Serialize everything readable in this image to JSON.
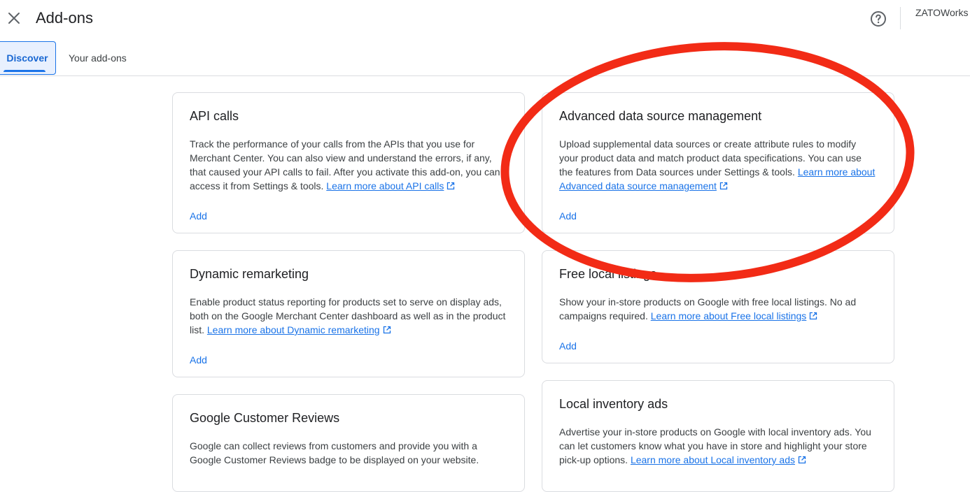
{
  "header": {
    "title": "Add-ons",
    "account": "ZATOWorks",
    "close_icon": "close-icon",
    "help_icon": "help-circle-icon"
  },
  "tabs": [
    {
      "label": "Discover",
      "selected": true
    },
    {
      "label": "Your add-ons",
      "selected": false
    }
  ],
  "cards": {
    "api_calls": {
      "title": "API calls",
      "desc": "Track the performance of your calls from the APIs that you use for Merchant Center. You can also view and understand the errors, if any, that caused your API calls to fail. After you activate this add-on, you can access it from Settings & tools.",
      "link": "Learn more about API calls",
      "action": "Add"
    },
    "advanced_data": {
      "title": "Advanced data source management",
      "desc": "Upload supplemental data sources or create attribute rules to modify your product data and match product data specifications. You can use the features from Data sources under Settings & tools.",
      "link": "Learn more about Advanced data source management",
      "action": "Add"
    },
    "dynamic_remarketing": {
      "title": "Dynamic remarketing",
      "desc": "Enable product status reporting for products set to serve on display ads, both on the Google Merchant Center dashboard as well as in the product list.",
      "link": "Learn more about Dynamic remarketing",
      "action": "Add"
    },
    "free_local_listings": {
      "title": "Free local listings",
      "desc": "Show your in-store products on Google with free local listings. No ad campaigns required.",
      "link": "Learn more about Free local listings",
      "action": "Add"
    },
    "google_customer_reviews": {
      "title": "Google Customer Reviews",
      "desc": "Google can collect reviews from customers and provide you with a Google Customer Reviews badge to be displayed on your website.",
      "link": "",
      "action": ""
    },
    "local_inventory_ads": {
      "title": "Local inventory ads",
      "desc": "Advertise your in-store products on Google with local inventory ads. You can let customers know what you have in store and highlight your store pick-up options.",
      "link": "Learn more about Local inventory ads",
      "action": ""
    }
  },
  "colors": {
    "accent": "#1a73e8",
    "annotation_red": "#f22b16"
  }
}
